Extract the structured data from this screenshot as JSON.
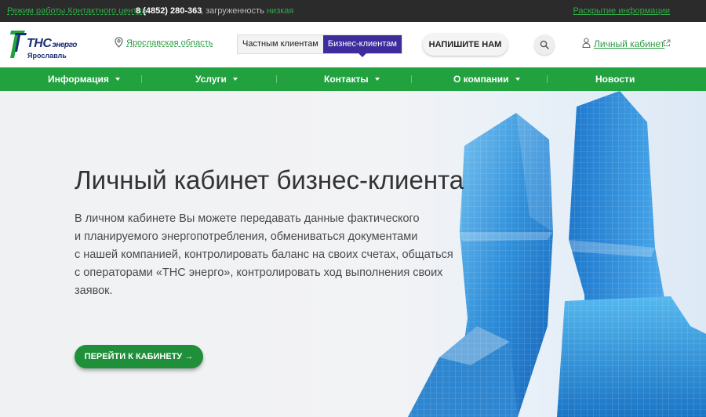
{
  "topbar": {
    "hours_link": "Режим работы Контактного центра",
    "phone": "8 (4852) 280-363",
    "load_prefix": ", загруженность",
    "load_level": "низкая",
    "disclosure_link": "Раскрытие информации"
  },
  "header": {
    "logo": {
      "name": "ТНС",
      "name_sub": "энерго",
      "city": "Ярославль"
    },
    "region": "Ярославская область",
    "segments": [
      "Частным клиентам",
      "Бизнес-клиентам"
    ],
    "active_segment": "Бизнес-клиентам",
    "write_button": "НАПИШИТЕ НАМ",
    "cabinet_link": "Личный кабинет"
  },
  "nav": {
    "items": [
      {
        "label": "Информация",
        "dropdown": true
      },
      {
        "label": "Услуги",
        "dropdown": true
      },
      {
        "label": "Контакты",
        "dropdown": true
      },
      {
        "label": "О компании",
        "dropdown": true
      },
      {
        "label": "Новости",
        "dropdown": false
      }
    ]
  },
  "hero": {
    "title": "Личный кабинет бизнес-клиента",
    "lines": [
      "В личном кабинете Вы можете передавать данные фактического",
      "и планируемого энергопотребления, обмениваться документами",
      "с нашей компанией, контролировать баланс на своих счетах, общаться",
      "с операторами «ТНС энерго», контролировать ход выполнения своих",
      "заявок."
    ],
    "cta": "ПЕРЕЙТИ К КАБИНЕТУ →"
  },
  "colors": {
    "brand_green": "#21a23f",
    "brand_purple": "#3d2d9c",
    "logo_blue": "#1c2f75",
    "topbar": "#2b2b2b"
  },
  "icons": {
    "region": "map-pin-icon",
    "search": "search-icon",
    "cabinet": "user-icon",
    "external": "external-link-icon"
  }
}
